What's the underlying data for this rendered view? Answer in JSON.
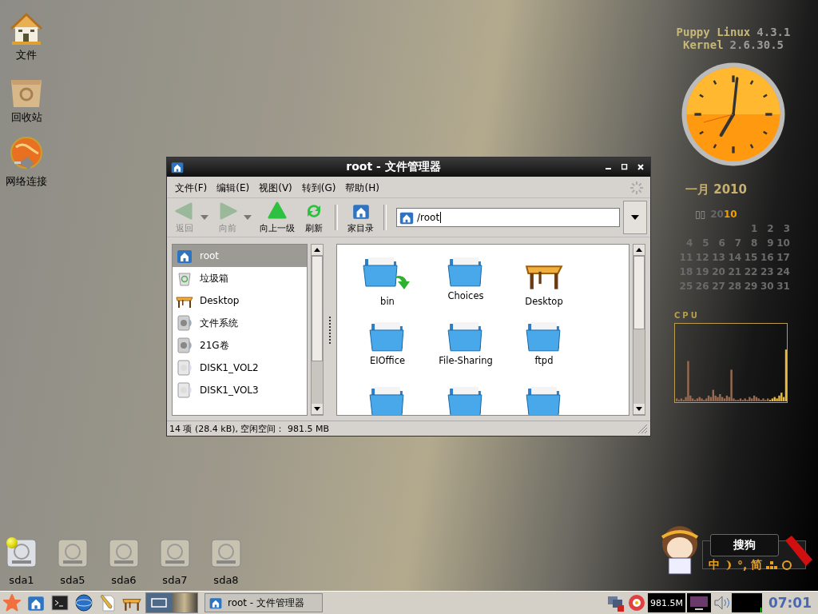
{
  "desktop_icons": [
    {
      "label": "文件",
      "kind": "home"
    },
    {
      "label": "回收站",
      "kind": "trash"
    },
    {
      "label": "网络连接",
      "kind": "network"
    }
  ],
  "system_info": [
    {
      "name": "Puppy Linux",
      "value": "4.3.1"
    },
    {
      "name": "Kernel",
      "value": "2.6.30.5"
    }
  ],
  "calendar": {
    "title": "一月 2010",
    "header_label": "▯▯",
    "year_start": "20",
    "year_end": "10",
    "weeks": [
      [
        "1",
        "2",
        "3"
      ],
      [
        "4",
        "5",
        "6",
        "7",
        "8",
        "9",
        "10"
      ],
      [
        "11",
        "12",
        "13",
        "14",
        "15",
        "16",
        "17"
      ],
      [
        "18",
        "19",
        "20",
        "21",
        "22",
        "23",
        "24"
      ],
      [
        "25",
        "26",
        "27",
        "28",
        "29",
        "30",
        "31"
      ]
    ]
  },
  "cpu_monitor": {
    "label": "CPU"
  },
  "window": {
    "title": "root - 文件管理器",
    "menu": [
      "文件(F)",
      "编辑(E)",
      "视图(V)",
      "转到(G)",
      "帮助(H)"
    ],
    "toolbar": [
      {
        "label": "返回",
        "kind": "back",
        "disabled": true,
        "dropdown": true
      },
      {
        "label": "向前",
        "kind": "forward",
        "disabled": true,
        "dropdown": true
      },
      {
        "label": "向上一级",
        "kind": "up",
        "disabled": false,
        "dropdown": false
      },
      {
        "label": "刷新",
        "kind": "refresh",
        "disabled": false,
        "dropdown": false
      },
      {
        "label": "家目录",
        "kind": "home",
        "disabled": false,
        "dropdown": false
      }
    ],
    "location": "/root",
    "places": [
      {
        "label": "root",
        "kind": "home",
        "selected": true
      },
      {
        "label": "垃圾箱",
        "kind": "trash",
        "selected": false
      },
      {
        "label": "Desktop",
        "kind": "desktop",
        "selected": false
      },
      {
        "label": "文件系统",
        "kind": "disk",
        "selected": false
      },
      {
        "label": "21G卷",
        "kind": "disk",
        "selected": false
      },
      {
        "label": "DISK1_VOL2",
        "kind": "volume",
        "selected": false
      },
      {
        "label": "DISK1_VOL3",
        "kind": "volume",
        "selected": false
      }
    ],
    "files": [
      {
        "label": "bin",
        "kind": "link"
      },
      {
        "label": "Choices",
        "kind": "folder"
      },
      {
        "label": "Desktop",
        "kind": "desktop"
      },
      {
        "label": "EIOffice",
        "kind": "folder"
      },
      {
        "label": "File-Sharing",
        "kind": "folder"
      },
      {
        "label": "ftpd",
        "kind": "folder"
      },
      {
        "kind": "folder"
      },
      {
        "kind": "folder"
      },
      {
        "kind": "folder"
      }
    ],
    "status": "14 项 (28.4 kB), 空闲空间： 981.5 MB"
  },
  "drives": [
    {
      "label": "sda1",
      "mounted": true
    },
    {
      "label": "sda5",
      "mounted": false
    },
    {
      "label": "sda6",
      "mounted": false
    },
    {
      "label": "sda7",
      "mounted": false
    },
    {
      "label": "sda8",
      "mounted": false
    }
  ],
  "ime": {
    "logo": "搜狗",
    "mode": "中",
    "punctuation": "°,",
    "script": "简"
  },
  "taskbar": {
    "launchers": [
      {
        "kind": "menu"
      },
      {
        "kind": "home"
      },
      {
        "kind": "terminal"
      },
      {
        "kind": "browser"
      },
      {
        "kind": "editor"
      },
      {
        "kind": "desktop"
      }
    ],
    "pager": [
      {
        "selected": true
      },
      {
        "selected": false
      }
    ],
    "tasks": [
      {
        "label": "root - 文件管理器"
      }
    ],
    "memory": "981.5M",
    "time": "07:01"
  }
}
